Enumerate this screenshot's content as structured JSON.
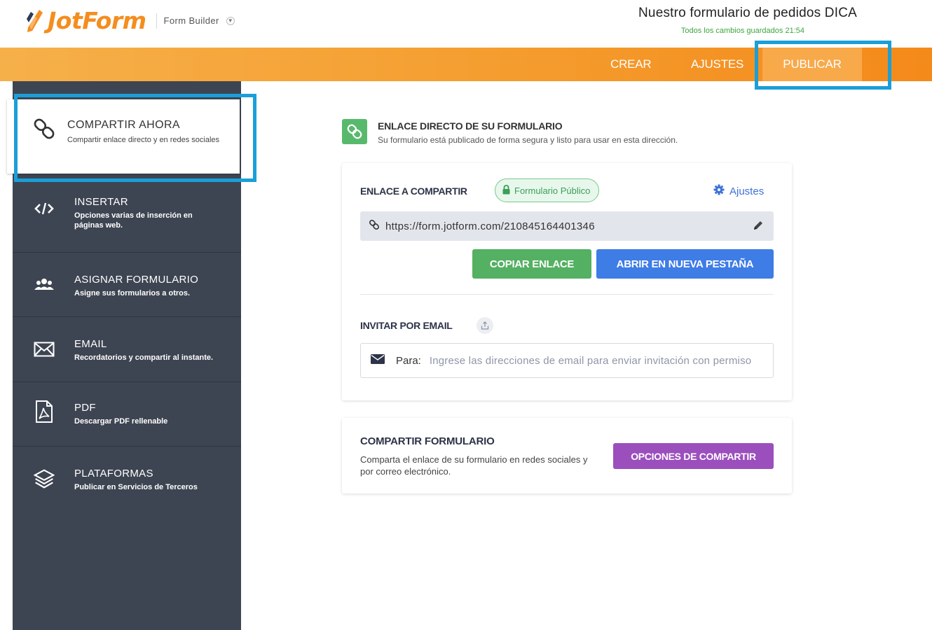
{
  "header": {
    "brand": "JotForm",
    "builder_label": "Form Builder",
    "form_title": "Nuestro formulario de pedidos DICA",
    "save_status": "Todos los cambios guardados 21:54"
  },
  "nav": {
    "crear": "CREAR",
    "ajustes": "AJUSTES",
    "publicar": "PUBLICAR"
  },
  "sidebar": {
    "items": [
      {
        "title": "COMPARTIR AHORA",
        "subtitle": "Compartir enlace directo y en redes sociales",
        "icon": "link-icon",
        "active": true
      },
      {
        "title": "INSERTAR",
        "subtitle": "Opciones varias de inserción en páginas web.",
        "icon": "code-icon"
      },
      {
        "title": "ASIGNAR FORMULARIO",
        "subtitle": "Asigne sus formularios a otros.",
        "icon": "users-icon"
      },
      {
        "title": "EMAIL",
        "subtitle": "Recordatorios y compartir al instante.",
        "icon": "envelope-icon"
      },
      {
        "title": "PDF",
        "subtitle": "Descargar PDF rellenable",
        "icon": "pdf-icon"
      },
      {
        "title": "PLATAFORMAS",
        "subtitle": "Publicar en Servicios de Terceros",
        "icon": "layers-icon"
      }
    ]
  },
  "direct_link": {
    "title": "ENLACE DIRECTO DE SU FORMULARIO",
    "subtitle": "Su formulario está publicado de forma segura y listo para usar en esta dirección."
  },
  "share_card": {
    "label": "ENLACE A COMPARTIR",
    "badge": "Formulario Público",
    "settings_link": "Ajustes",
    "url": "https://form.jotform.com/210845164401346",
    "copy_button": "COPIAR ENLACE",
    "open_button": "ABRIR EN NUEVA PESTAÑA",
    "invite_label": "INVITAR POR EMAIL",
    "to_label": "Para:",
    "email_placeholder": "Ingrese las direcciones de email para enviar invitación con permiso"
  },
  "share_form": {
    "title": "COMPARTIR FORMULARIO",
    "subtitle": "Comparta el enlace de su formulario en redes sociales y por correo electrónico.",
    "button": "OPCIONES DE COMPARTIR"
  },
  "colors": {
    "brand_orange": "#f58d1f",
    "sidebar_bg": "#3e4552",
    "highlight_blue": "#1a9fd9",
    "copy_green": "#54b062",
    "open_blue": "#3e7ce6",
    "share_purple": "#9b4fbd"
  }
}
